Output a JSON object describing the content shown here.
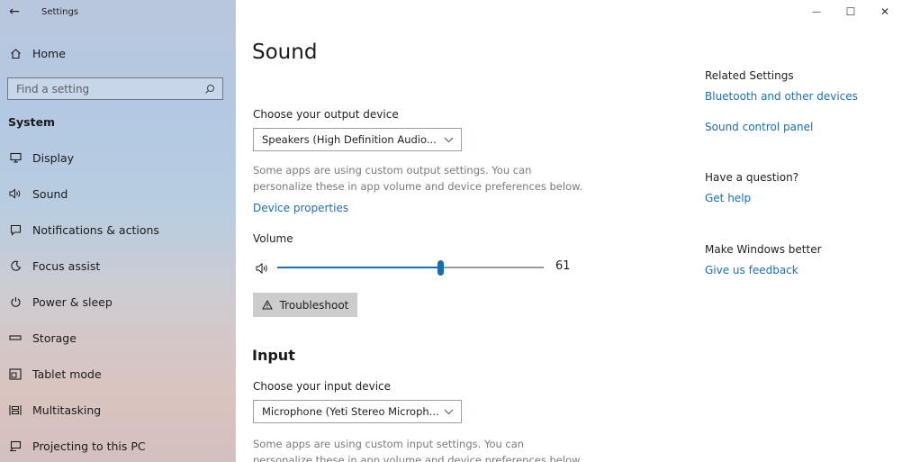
{
  "window": {
    "title": "Settings",
    "controls": {
      "minimize": "—",
      "maximize": "☐",
      "close": "✕"
    }
  },
  "sidebar": {
    "home_label": "Home",
    "search": {
      "placeholder": "Find a setting",
      "value": ""
    },
    "section_label": "System",
    "items": [
      {
        "label": "Display",
        "icon": "display-icon"
      },
      {
        "label": "Sound",
        "icon": "sound-icon"
      },
      {
        "label": "Notifications & actions",
        "icon": "notifications-icon"
      },
      {
        "label": "Focus assist",
        "icon": "focus-assist-icon"
      },
      {
        "label": "Power & sleep",
        "icon": "power-icon"
      },
      {
        "label": "Storage",
        "icon": "storage-icon"
      },
      {
        "label": "Tablet mode",
        "icon": "tablet-mode-icon"
      },
      {
        "label": "Multitasking",
        "icon": "multitasking-icon"
      },
      {
        "label": "Projecting to this PC",
        "icon": "projecting-icon"
      }
    ]
  },
  "main": {
    "title": "Sound",
    "output": {
      "label": "Choose your output device",
      "selected": "Speakers (High Definition Audio...",
      "help": "Some apps are using custom output settings. You can personalize these in app volume and device preferences below.",
      "device_properties_link": "Device properties"
    },
    "volume": {
      "label": "Volume",
      "value": 61,
      "display": "61",
      "fill_fraction": 0.61
    },
    "troubleshoot_label": "Troubleshoot",
    "input": {
      "section_title": "Input",
      "label": "Choose your input device",
      "selected": "Microphone (Yeti Stereo Microph...",
      "help": "Some apps are using custom input settings. You can personalize these in app volume and device preferences below."
    }
  },
  "related": {
    "heading": "Related Settings",
    "links": [
      "Bluetooth and other devices",
      "Sound control panel"
    ],
    "question_heading": "Have a question?",
    "question_link": "Get help",
    "better_heading": "Make Windows better",
    "better_link": "Give us feedback"
  },
  "colors": {
    "accent": "#1a6fbf",
    "slider": "#1e6fb5",
    "button_bg": "#cccccc"
  }
}
